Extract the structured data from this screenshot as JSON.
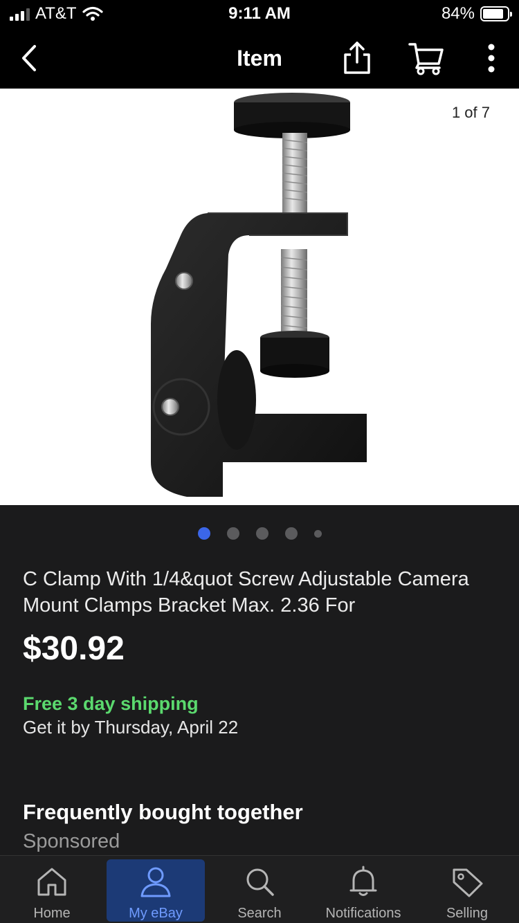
{
  "status_bar": {
    "carrier": "AT&T",
    "time": "9:11 AM",
    "battery": "84%",
    "battery_level": 0.84,
    "icons": [
      "signal-icon",
      "wifi-icon",
      "battery-icon"
    ]
  },
  "nav": {
    "title": "Item",
    "icons": [
      "back-icon",
      "share-icon",
      "cart-icon",
      "more-icon"
    ]
  },
  "gallery": {
    "counter": "1 of 7",
    "active_index": 0,
    "dot_count": 5
  },
  "product": {
    "title": "C Clamp With 1/4&quot Screw Adjustable Camera Mount Clamps Bracket Max. 2.36 For",
    "price": "$30.92",
    "shipping": "Free 3 day shipping",
    "delivery": "Get it by Thursday, April 22"
  },
  "section": {
    "title": "Frequently bought together",
    "subtitle": "Sponsored"
  },
  "tabs": [
    {
      "label": "Home",
      "icon": "home-icon"
    },
    {
      "label": "My eBay",
      "icon": "user-icon",
      "active": true
    },
    {
      "label": "Search",
      "icon": "search-icon"
    },
    {
      "label": "Notifications",
      "icon": "bell-icon"
    },
    {
      "label": "Selling",
      "icon": "tag-icon"
    }
  ],
  "colors": {
    "accent": "#3b66e8",
    "shipping": "#5bd96e",
    "background": "#1b1b1c",
    "active_tab": "#1c3a76"
  }
}
